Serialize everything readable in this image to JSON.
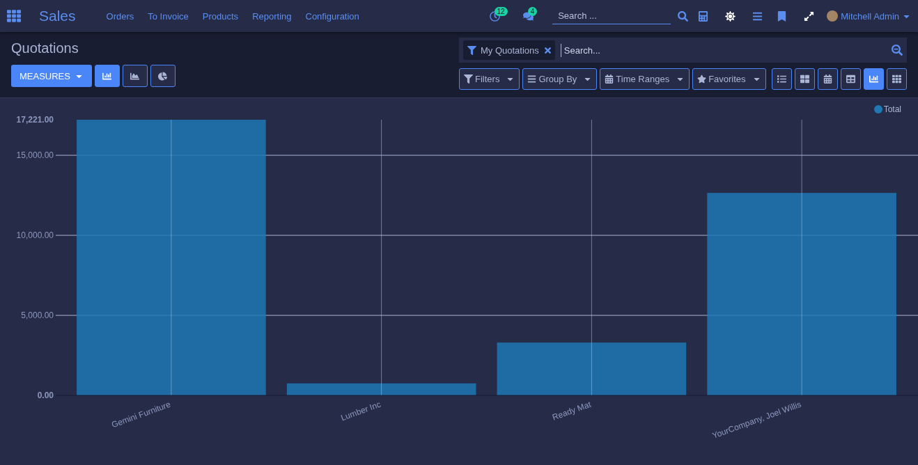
{
  "navbar": {
    "app_title": "Sales",
    "menu": [
      "Orders",
      "To Invoice",
      "Products",
      "Reporting",
      "Configuration"
    ],
    "activity_count": "12",
    "message_count": "4",
    "search": {
      "placeholder": "Search ..."
    },
    "user_name": "Mitchell Admin"
  },
  "control_panel": {
    "breadcrumb": "Quotations",
    "measures_label": "MEASURES",
    "chart_modes": [
      {
        "kind": "bar",
        "selected": true
      },
      {
        "kind": "line",
        "selected": false
      },
      {
        "kind": "pie",
        "selected": false
      }
    ],
    "facets": [
      {
        "label": "My Quotations"
      }
    ],
    "search": {
      "placeholder": "Search..."
    },
    "filter_buttons": [
      {
        "kind": "filter",
        "label": "Filters"
      },
      {
        "kind": "group",
        "label": "Group By"
      },
      {
        "kind": "time",
        "label": "Time Ranges"
      },
      {
        "kind": "favorite",
        "label": "Favorites"
      }
    ],
    "view_modes": [
      {
        "kind": "list",
        "selected": false
      },
      {
        "kind": "kanban",
        "selected": false
      },
      {
        "kind": "calendar",
        "selected": false
      },
      {
        "kind": "pivot",
        "selected": false
      },
      {
        "kind": "graph",
        "selected": true
      },
      {
        "kind": "grid",
        "selected": false
      }
    ]
  },
  "chart_data": {
    "type": "bar",
    "categories": [
      "Gemini Furniture",
      "Lumber Inc",
      "Ready Mat",
      "YourCompany, Joel Willis"
    ],
    "series": [
      {
        "name": "Total",
        "color": "#1f77b4",
        "values": [
          17221,
          750,
          3300,
          12650
        ]
      }
    ],
    "grid": true,
    "ylim": [
      0,
      17221
    ],
    "yticks": [
      {
        "value": 0,
        "label": "0.00"
      },
      {
        "value": 5000,
        "label": "5,000.00"
      },
      {
        "value": 10000,
        "label": "10,000.00"
      },
      {
        "value": 15000,
        "label": "15,000.00"
      },
      {
        "value": 17221,
        "label": "17,221.00"
      }
    ]
  }
}
